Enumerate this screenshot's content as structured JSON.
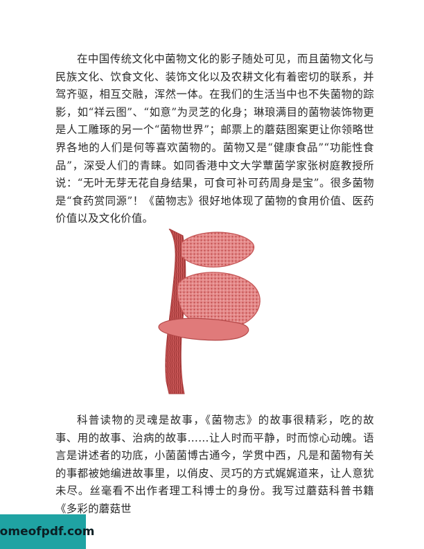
{
  "body": {
    "paragraph_1": "在中国传统文化中菌物文化的影子随处可见，而且菌物文化与民族文化、饮食文化、装饰文化以及农耕文化有着密切的联系，并驾齐驱，相互交融，浑然一体。在我们的生活当中也不失菌物的踪影，如“祥云图”、“如意”为灵芝的化身；琳琅满目的菌物装饰物更是人工雕琢的另一个“菌物世界”；邮票上的蘑菇图案更让你领略世界各地的人们是何等喜欢菌物的。菌物又是“健康食品”“功能性食品”，深受人们的青睐。如同香港中文大学蕈菌学家张树庭教授所说：“无叶无芽无花自身结果，可食可补可药周身是宝”。很多菌物是“食药赏同源”！《菌物志》很好地体现了菌物的食用价值、医药价值以及文化价值。",
    "paragraph_2": "科普读物的灵魂是故事，《菌物志》的故事很精彩，吃的故事、用的故事、治病的故事……让人时而平静，时而惊心动魄。语言是讲述者的功底，小菌菌博古通今，学贯中西，凡是和菌物有关的事都被她编进故事里，以俏皮、灵巧的方式娓娓道来，让人意犹未尽。丝毫看不出作者理工科博士的身份。我写过蘑菇科普书籍《多彩的蘑菇世"
  },
  "figure": {
    "icon": "bracket-fungus-illustration",
    "color": "#d46b6b"
  },
  "watermark": {
    "text": "homeofpdf.com",
    "color": "#1fa3a3"
  }
}
